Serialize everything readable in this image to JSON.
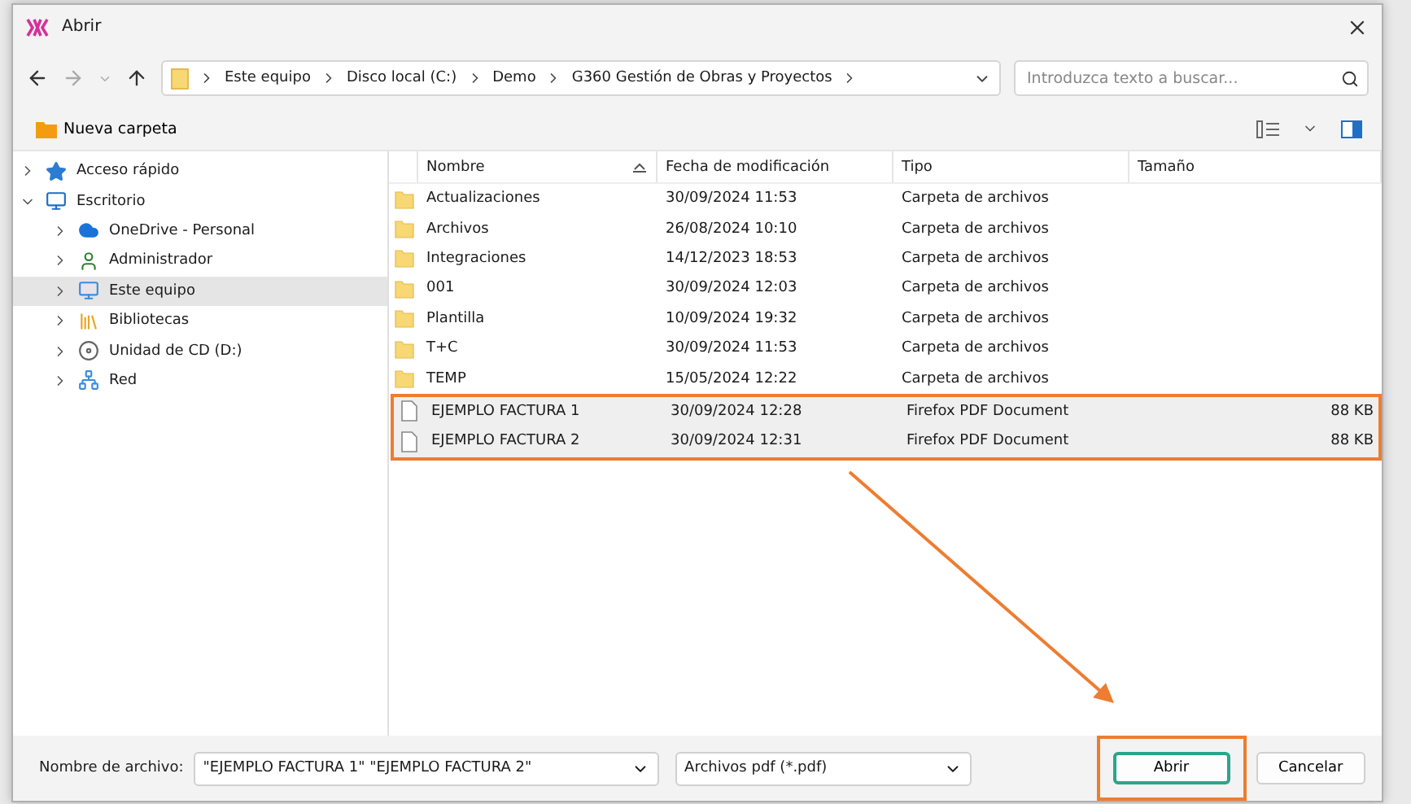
{
  "window": {
    "title": "Abrir"
  },
  "address": {
    "crumbs": [
      "Este equipo",
      "Disco local (C:)",
      "Demo",
      "G360 Gestión de Obras y Proyectos"
    ]
  },
  "search": {
    "placeholder": "Introduzca texto a buscar..."
  },
  "toolbar": {
    "new_folder": "Nueva carpeta"
  },
  "sidebar": {
    "items": [
      {
        "label": "Acceso rápido",
        "kind": "star",
        "expanded": false,
        "selected": false
      },
      {
        "label": "Escritorio",
        "kind": "desktop",
        "expanded": true,
        "selected": false,
        "children": [
          {
            "label": "OneDrive - Personal",
            "kind": "cloud",
            "expanded": false,
            "selected": false
          },
          {
            "label": "Administrador",
            "kind": "user",
            "expanded": false,
            "selected": false
          },
          {
            "label": "Este equipo",
            "kind": "pc",
            "expanded": false,
            "selected": true
          },
          {
            "label": "Bibliotecas",
            "kind": "library",
            "expanded": false,
            "selected": false
          },
          {
            "label": "Unidad de CD (D:)",
            "kind": "cd",
            "expanded": false,
            "selected": false
          },
          {
            "label": "Red",
            "kind": "network",
            "expanded": false,
            "selected": false
          }
        ]
      }
    ]
  },
  "table": {
    "columns": [
      "Nombre",
      "Fecha de modificación",
      "Tipo",
      "Tamaño"
    ],
    "rows": [
      {
        "kind": "folder",
        "name": "Actualizaciones",
        "date": "30/09/2024 11:53",
        "type": "Carpeta de archivos",
        "selected": false
      },
      {
        "kind": "folder",
        "name": "Archivos",
        "date": "26/08/2024 10:10",
        "type": "Carpeta de archivos",
        "selected": false
      },
      {
        "kind": "folder",
        "name": "Integraciones",
        "date": "14/12/2023 18:53",
        "type": "Carpeta de archivos",
        "selected": false
      },
      {
        "kind": "folder",
        "name": "001",
        "date": "30/09/2024 12:03",
        "type": "Carpeta de archivos",
        "selected": false
      },
      {
        "kind": "folder",
        "name": "Plantilla",
        "date": "10/09/2024 19:32",
        "type": "Carpeta de archivos",
        "selected": false
      },
      {
        "kind": "folder",
        "name": "T+C",
        "date": "30/09/2024 11:53",
        "type": "Carpeta de archivos",
        "selected": false
      },
      {
        "kind": "folder",
        "name": "TEMP",
        "date": "15/05/2024 12:22",
        "type": "Carpeta de archivos",
        "selected": false
      },
      {
        "kind": "file",
        "name": "EJEMPLO FACTURA 1",
        "date": "30/09/2024 12:28",
        "type": "Firefox PDF Document",
        "size": "88 KB",
        "selected": true
      },
      {
        "kind": "file",
        "name": "EJEMPLO FACTURA 2",
        "date": "30/09/2024 12:31",
        "type": "Firefox PDF Document",
        "size": "88 KB",
        "selected": true
      }
    ]
  },
  "footer": {
    "filename_label": "Nombre de archivo:",
    "filename": "\"EJEMPLO FACTURA 1\" \"EJEMPLO FACTURA 2\"",
    "filter": "Archivos pdf (*.pdf)",
    "buttons": [
      "Abrir",
      "Cancelar"
    ]
  }
}
